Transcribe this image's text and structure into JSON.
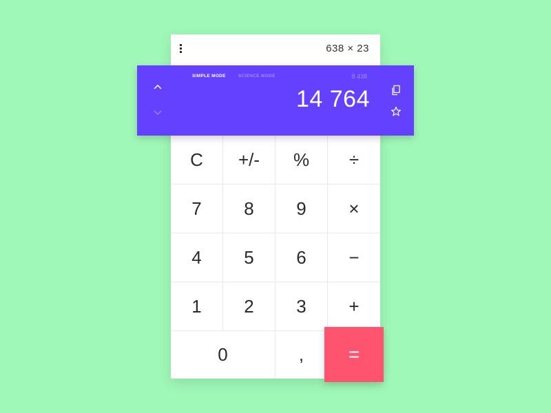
{
  "header": {
    "expression": "638 × 23",
    "menu_icon": "kebab-menu-icon"
  },
  "display": {
    "modes": [
      {
        "label": "SIMPLE MODE",
        "active": true
      },
      {
        "label": "SCIENCE MODE",
        "active": false
      }
    ],
    "previous_result": "8 438",
    "result": "14 764",
    "icons": {
      "up": "chevron-up-icon",
      "down": "chevron-down-icon",
      "copy": "copy-icon",
      "favorite": "star-icon"
    }
  },
  "keypad": {
    "rows": [
      [
        "C",
        "+/-",
        "%",
        "÷"
      ],
      [
        "7",
        "8",
        "9",
        "×"
      ],
      [
        "4",
        "5",
        "6",
        "−"
      ],
      [
        "1",
        "2",
        "3",
        "+"
      ]
    ],
    "zero": "0",
    "decimal": ",",
    "equals": "="
  },
  "colors": {
    "background": "#a0f8b8",
    "display": "#6441ff",
    "equals": "#ff5470"
  }
}
